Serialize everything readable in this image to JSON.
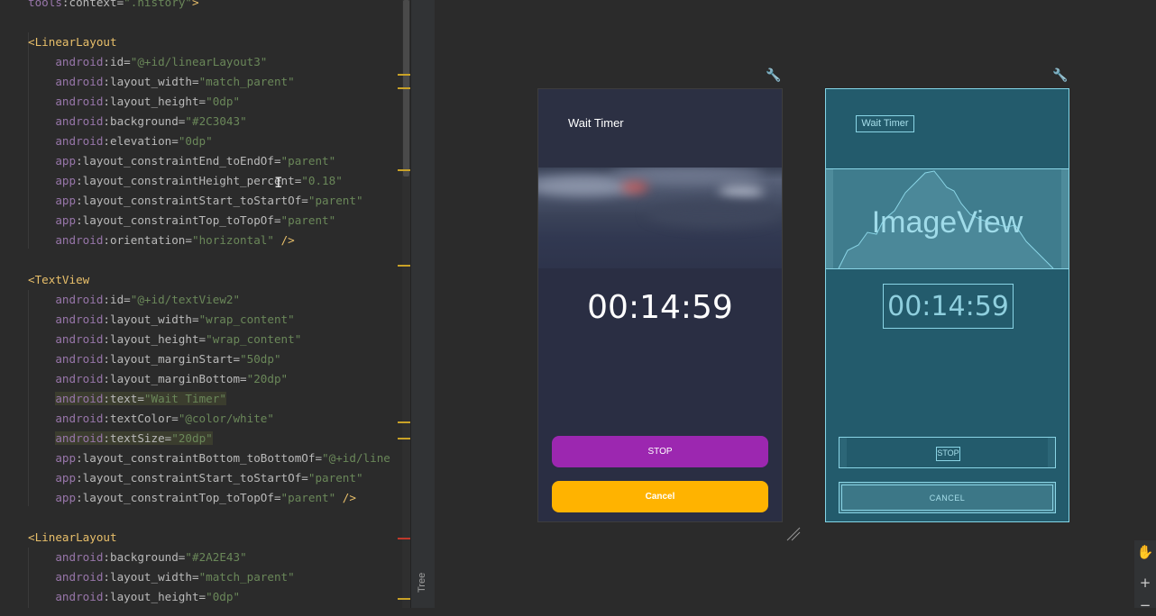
{
  "editor": {
    "lines": [
      [
        [
          "ns",
          "tools"
        ],
        [
          "attr",
          ":context="
        ],
        [
          "val",
          "\".history\""
        ],
        [
          "tag",
          ">"
        ]
      ],
      [],
      [
        [
          "tag",
          "<LinearLayout"
        ]
      ],
      [
        [
          "ns",
          "    android"
        ],
        [
          "attr",
          ":id="
        ],
        [
          "val",
          "\"@+id/linearLayout3\""
        ]
      ],
      [
        [
          "ns",
          "    android"
        ],
        [
          "attr",
          ":layout_width="
        ],
        [
          "val",
          "\"match_parent\""
        ]
      ],
      [
        [
          "ns",
          "    android"
        ],
        [
          "attr",
          ":layout_height="
        ],
        [
          "val",
          "\"0dp\""
        ]
      ],
      [
        [
          "ns",
          "    android"
        ],
        [
          "attr",
          ":background="
        ],
        [
          "val",
          "\"#2C3043\""
        ]
      ],
      [
        [
          "ns",
          "    android"
        ],
        [
          "attr",
          ":elevation="
        ],
        [
          "val",
          "\"0dp\""
        ]
      ],
      [
        [
          "ns",
          "    app"
        ],
        [
          "attr",
          ":layout_constraintEnd_toEndOf="
        ],
        [
          "val",
          "\"parent\""
        ]
      ],
      [
        [
          "ns",
          "    app"
        ],
        [
          "attr",
          ":layout_constraintHeight_percent="
        ],
        [
          "val",
          "\"0.18\""
        ]
      ],
      [
        [
          "ns",
          "    app"
        ],
        [
          "attr",
          ":layout_constraintStart_toStartOf="
        ],
        [
          "val",
          "\"parent\""
        ]
      ],
      [
        [
          "ns",
          "    app"
        ],
        [
          "attr",
          ":layout_constraintTop_toTopOf="
        ],
        [
          "val",
          "\"parent\""
        ]
      ],
      [
        [
          "ns",
          "    android"
        ],
        [
          "attr",
          ":orientation="
        ],
        [
          "val",
          "\"horizontal\""
        ],
        [
          "tag",
          " />"
        ]
      ],
      [],
      [
        [
          "tag",
          "<TextView"
        ]
      ],
      [
        [
          "ns",
          "    android"
        ],
        [
          "attr",
          ":id="
        ],
        [
          "val",
          "\"@+id/textView2\""
        ]
      ],
      [
        [
          "ns",
          "    android"
        ],
        [
          "attr",
          ":layout_width="
        ],
        [
          "val",
          "\"wrap_content\""
        ]
      ],
      [
        [
          "ns",
          "    android"
        ],
        [
          "attr",
          ":layout_height="
        ],
        [
          "val",
          "\"wrap_content\""
        ]
      ],
      [
        [
          "ns",
          "    android"
        ],
        [
          "attr",
          ":layout_marginStart="
        ],
        [
          "val",
          "\"50dp\""
        ]
      ],
      [
        [
          "ns",
          "    android"
        ],
        [
          "attr",
          ":layout_marginBottom="
        ],
        [
          "val",
          "\"20dp\""
        ]
      ],
      [
        [
          "ns",
          "    android",
          "hl"
        ],
        [
          "attr",
          ":text=",
          "hl"
        ],
        [
          "val",
          "\"Wait Timer\"",
          "hl"
        ]
      ],
      [
        [
          "ns",
          "    android"
        ],
        [
          "attr",
          ":textColor="
        ],
        [
          "val",
          "\"@color/white\""
        ]
      ],
      [
        [
          "ns",
          "    android",
          "hl"
        ],
        [
          "attr",
          ":textSize=",
          "hl"
        ],
        [
          "val",
          "\"20dp\"",
          "hl"
        ]
      ],
      [
        [
          "ns",
          "    app"
        ],
        [
          "attr",
          ":layout_constraintBottom_toBottomOf="
        ],
        [
          "val",
          "\"@+id/line"
        ]
      ],
      [
        [
          "ns",
          "    app"
        ],
        [
          "attr",
          ":layout_constraintStart_toStartOf="
        ],
        [
          "val",
          "\"parent\""
        ]
      ],
      [
        [
          "ns",
          "    app"
        ],
        [
          "attr",
          ":layout_constraintTop_toTopOf="
        ],
        [
          "val",
          "\"parent\""
        ],
        [
          "tag",
          " />"
        ]
      ],
      [],
      [
        [
          "tag",
          "<LinearLayout"
        ]
      ],
      [
        [
          "ns",
          "    android"
        ],
        [
          "attr",
          ":background="
        ],
        [
          "val",
          "\"#2A2E43\""
        ]
      ],
      [
        [
          "ns",
          "    android"
        ],
        [
          "attr",
          ":layout_width="
        ],
        [
          "val",
          "\"match_parent\""
        ]
      ],
      [
        [
          "ns",
          "    android"
        ],
        [
          "attr",
          ":layout_height="
        ],
        [
          "val",
          "\"0dp\""
        ]
      ]
    ]
  },
  "tree_label": "Tree",
  "design": {
    "title": "Wait Timer",
    "timer": "00:14:59",
    "stop_label": "STOP",
    "cancel_label": "Cancel",
    "colors": {
      "stop": "#9C27B0",
      "cancel": "#FFB300",
      "header": "#2C3043",
      "body": "#2A2E43"
    }
  },
  "blueprint": {
    "title": "Wait Timer",
    "image_label": "ImageView",
    "timer": "00:14:59",
    "stop_label": "STOP",
    "cancel_label": "CANCEL"
  },
  "icons": {
    "pin": "wrench-icon",
    "pan": "hand-icon",
    "zoom_in": "plus-icon",
    "zoom_out": "minus-icon"
  }
}
